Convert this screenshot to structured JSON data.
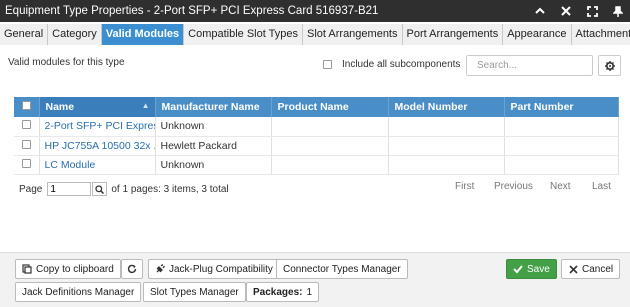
{
  "window": {
    "title": "Equipment Type Properties - 2-Port SFP+ PCI Express Card 516937-B21",
    "controls": [
      "chevron-up-icon",
      "close-icon",
      "expand-icon",
      "pin-icon"
    ]
  },
  "tabs": [
    {
      "label": "General",
      "active": false
    },
    {
      "label": "Category",
      "active": false
    },
    {
      "label": "Valid Modules",
      "active": true
    },
    {
      "label": "Compatible Slot Types",
      "active": false
    },
    {
      "label": "Slot Arrangements",
      "active": false
    },
    {
      "label": "Port Arrangements",
      "active": false
    },
    {
      "label": "Appearance",
      "active": false
    },
    {
      "label": "Attachments",
      "active": false
    }
  ],
  "main": {
    "subtitle": "Valid modules for this type",
    "include_all_label": "Include all subcomponents",
    "search_placeholder": "Search..."
  },
  "table": {
    "columns": [
      "Name",
      "Manufacturer Name",
      "Product Name",
      "Model Number",
      "Part Number"
    ],
    "rows": [
      {
        "name": "2-Port SFP+ PCI Expres...",
        "manufacturer": "Unknown",
        "product": "",
        "model": "",
        "part": ""
      },
      {
        "name": "HP JC755A 10500 32x ...",
        "manufacturer": "Hewlett Packard",
        "product": "",
        "model": "",
        "part": ""
      },
      {
        "name": "LC Module",
        "manufacturer": "Unknown",
        "product": "",
        "model": "",
        "part": ""
      }
    ]
  },
  "pager": {
    "page_label": "Page",
    "page_value": "1",
    "info": "of 1 pages: 3 items, 3 total",
    "first": "First",
    "previous": "Previous",
    "next": "Next",
    "last": "Last"
  },
  "footer": {
    "copy_label": "Copy to clipboard",
    "jack_plug_label": "Jack-Plug Compatibility",
    "connector_label": "Connector Types Manager",
    "save_label": "Save",
    "cancel_label": "Cancel",
    "jack_def_label": "Jack Definitions Manager",
    "slot_types_label": "Slot Types Manager",
    "packages_label": "Packages:",
    "packages_count": "1"
  },
  "colors": {
    "titlebar": "#2f2f2f",
    "active_tab": "#3b8fd0",
    "grid_header": "#4a8ec8",
    "link": "#2a6eaf",
    "save": "#43a047"
  }
}
